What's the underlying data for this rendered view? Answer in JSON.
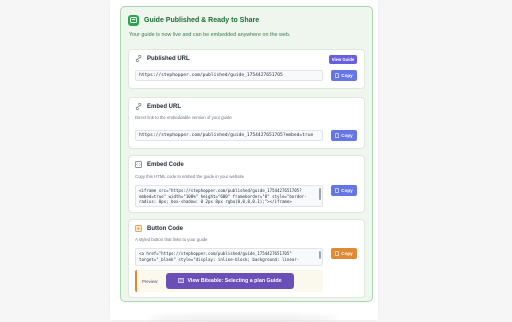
{
  "header": {
    "title": "Guide Published & Ready to Share",
    "subtitle": "Your guide is now live and can be embedded anywhere on the web."
  },
  "published_url": {
    "title": "Published URL",
    "view_label": "View Guide",
    "value": "https://stephopper.com/published/guide_17544276517O5",
    "copy_label": "Copy"
  },
  "embed_url": {
    "title": "Embed URL",
    "description": "Direct link to the embeddable version of your guide",
    "value": "https://stephopper.com/published/guide_17544276517O5?embed=true",
    "copy_label": "Copy"
  },
  "embed_code": {
    "title": "Embed Code",
    "description": "Copy this HTML code to embed the guide in your website",
    "lines": [
      "<iframe src=\"https://stephopper.com/published/guide_1754427651705?",
      "embed=true\" width=\"100%\" height=\"600\" frameborder=\"0\" style=\"border-",
      "radius: 8px; box-shadow: 0 2px 8px rgba(0,0,0,0.1);\"></iframe>"
    ],
    "copy_label": "Copy"
  },
  "button_code": {
    "title": "Button Code",
    "description": "A styled button that links to your guide",
    "lines": [
      "<a href=\"https://stephopper.com/published/guide_1754427651705\"",
      "target=\"_blank\" style=\"display: inline-block; background: linear-"
    ],
    "copy_label": "Copy",
    "preview_label": "Preview:",
    "preview_button": "View Biteable: Selecting a plan Guide"
  },
  "colors": {
    "accent_green": "#22a94b",
    "copy_blue": "#6576e6",
    "copy_orange": "#e08a33",
    "view_purple": "#6a5ee0"
  },
  "icons": {
    "header": "check-badge-icon",
    "published_url": "link-icon",
    "embed_url": "link-icon",
    "embed_code": "code-icon",
    "button_code": "button-icon",
    "copy": "clipboard-icon"
  }
}
